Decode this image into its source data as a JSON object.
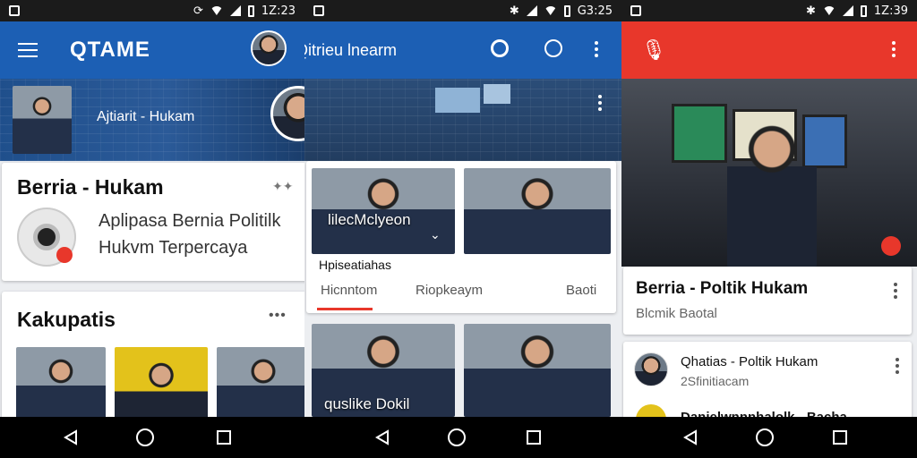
{
  "status": {
    "time_1": "1Z:23",
    "time_2": "G3:25",
    "time_3": "1Z:39"
  },
  "panel1": {
    "brand": "QTAME",
    "hero_caption": "Ajtiarit - Hukam",
    "card1": {
      "title": "Berria - Hukam",
      "subtitle_line1": "Aplipasa Bernia Politilk",
      "subtitle_line2": "Hukvm Terpercaya",
      "more_icon": "star-dots"
    },
    "card2": {
      "title": "Kakupatis",
      "more": "•••"
    }
  },
  "panel2": {
    "appbar_title": "Qitrieu lnearm",
    "card": {
      "thumb1_caption": "lilecMclyeon",
      "label": "Hpiseatiahas",
      "tabs": [
        "Hicnntom",
        "Riopkeaym",
        "Baoti"
      ]
    },
    "thumb3_caption": "quslike Dokil"
  },
  "panel3": {
    "main_card": {
      "title": "Berria - Poltik Hukam",
      "subtitle": "Blcmik Baotal"
    },
    "list_item": {
      "title": "Qhatias - Poltik Hukam",
      "subtitle": "2Sfinitiacam"
    },
    "list_item2_partial": "Danielwnnnhalolk - Bacha"
  },
  "colors": {
    "blue_appbar": "#1c5fb4",
    "red_appbar": "#e8372b",
    "tab_underline": "#e8372b"
  }
}
